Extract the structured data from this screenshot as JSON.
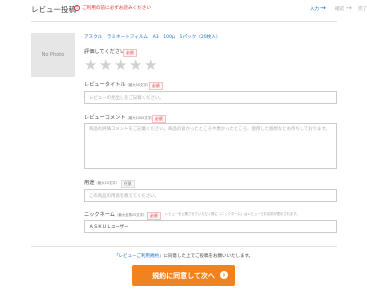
{
  "header": {
    "title": "レビュー投稿",
    "notice": "ご利用の前に必ずお読みください",
    "steps": [
      "入力",
      "確認",
      "完了"
    ]
  },
  "product": {
    "thumbnail_text": "No Photo",
    "name": "アスクル　ラミネートフィルム　A3　100μ　1パック（20枚入）"
  },
  "rating": {
    "label": "評価してください",
    "required": "必須",
    "stars": 0,
    "max": 5
  },
  "review_title": {
    "label": "レビュータイトル",
    "note": "（最大50文字）",
    "required": "必須",
    "placeholder": "レビューの見出しをご記載ください。"
  },
  "review_comment": {
    "label": "レビューコメント",
    "note": "（最大1000文字）",
    "required": "必須",
    "placeholder": "商品の評価コメントをご記載ください。商品の良かったところや悪かったところ、使用した感想などお待ちしております。"
  },
  "usage": {
    "label": "用途",
    "note": "（最大20文字）",
    "optional": "任意",
    "placeholder": "この商品の用途を教えてください。"
  },
  "nickname": {
    "label": "ニックネーム",
    "note": "（最大全角20文字）",
    "required": "必須",
    "hint": "レビューを公開させていただく際に（ニックネーム）はレビューでお名前が表示されます。",
    "value": "ＡＳＫＵＬユーザー"
  },
  "footer": {
    "terms_link": "「レビューご利用規約」",
    "terms_text": "に同意した上でご投稿をお願いいたします。",
    "submit_label": "規約に同意して次へ"
  },
  "colors": {
    "accent": "#f08320",
    "link": "#1a73c8",
    "required": "#dd3333"
  }
}
